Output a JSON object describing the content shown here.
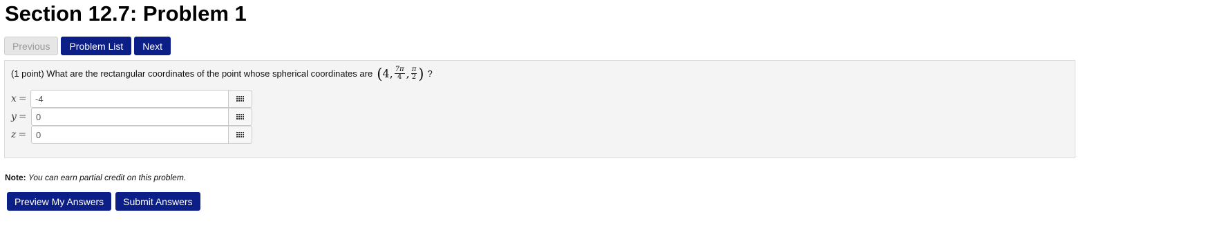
{
  "page": {
    "title": "Section 12.7: Problem 1"
  },
  "nav": {
    "previous_label": "Previous",
    "problem_list_label": "Problem List",
    "next_label": "Next"
  },
  "problem": {
    "question_text": "(1 point) What are the rectangular coordinates of the point whose spherical coordinates are",
    "coords": {
      "open_paren": "(",
      "rho": "4",
      "sep1": ", ",
      "theta_num": "7π",
      "theta_den": "4",
      "sep2": ", ",
      "phi_num": "π",
      "phi_den": "2",
      "close_paren": ")"
    },
    "question_mark": "?",
    "answers": [
      {
        "var": "x",
        "eq": "=",
        "value": "-4"
      },
      {
        "var": "y",
        "eq": "=",
        "value": "0"
      },
      {
        "var": "z",
        "eq": "=",
        "value": "0"
      }
    ]
  },
  "note": {
    "label": "Note:",
    "text": "You can earn partial credit on this problem."
  },
  "actions": {
    "preview_label": "Preview My Answers",
    "submit_label": "Submit Answers"
  },
  "colors": {
    "primary_button": "#0c1f87",
    "panel_bg": "#f4f4f4"
  },
  "icons": {
    "keyboard": "grid-keypad-icon"
  }
}
